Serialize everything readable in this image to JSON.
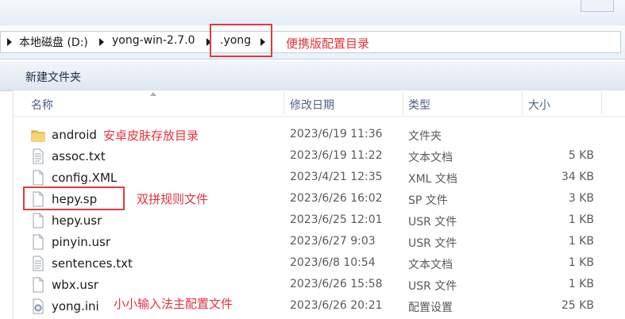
{
  "breadcrumb": {
    "items": [
      {
        "label": "本地磁盘 (D:)"
      },
      {
        "label": "yong-win-2.7.0"
      },
      {
        "label": ".yong"
      }
    ]
  },
  "toolbar": {
    "new_folder_label": "新建文件夹"
  },
  "columns": {
    "name": "名称",
    "date": "修改日期",
    "type": "类型",
    "size": "大小"
  },
  "files": [
    {
      "name": "android",
      "date": "2023/6/19 11:36",
      "type": "文件夹",
      "size": "",
      "icon": "folder-icon"
    },
    {
      "name": "assoc.txt",
      "date": "2023/6/19 11:22",
      "type": "文本文档",
      "size": "5 KB",
      "icon": "text-file-icon"
    },
    {
      "name": "config.XML",
      "date": "2023/4/21 12:35",
      "type": "XML 文档",
      "size": "34 KB",
      "icon": "file-icon"
    },
    {
      "name": "hepy.sp",
      "date": "2023/6/26 16:02",
      "type": "SP 文件",
      "size": "3 KB",
      "icon": "file-icon"
    },
    {
      "name": "hepy.usr",
      "date": "2023/6/25 12:01",
      "type": "USR 文件",
      "size": "1 KB",
      "icon": "file-icon"
    },
    {
      "name": "pinyin.usr",
      "date": "2023/6/27 9:03",
      "type": "USR 文件",
      "size": "1 KB",
      "icon": "file-icon"
    },
    {
      "name": "sentences.txt",
      "date": "2023/6/8 10:54",
      "type": "文本文档",
      "size": "1 KB",
      "icon": "text-file-icon"
    },
    {
      "name": "wbx.usr",
      "date": "2023/6/26 15:58",
      "type": "USR 文件",
      "size": "1 KB",
      "icon": "file-icon"
    },
    {
      "name": "yong.ini",
      "date": "2023/6/26 20:21",
      "type": "配置设置",
      "size": "25 KB",
      "icon": "settings-file-icon"
    }
  ],
  "annotations": {
    "portable_config": "便携版配置目录",
    "android_skin": "安卓皮肤存放目录",
    "shuangpin_rules": "双拼规则文件",
    "main_config": "小小输入法主配置文件"
  },
  "colors": {
    "annotation": "#e6323a",
    "folder": "#f3c34e",
    "header_text": "#4d6185"
  }
}
